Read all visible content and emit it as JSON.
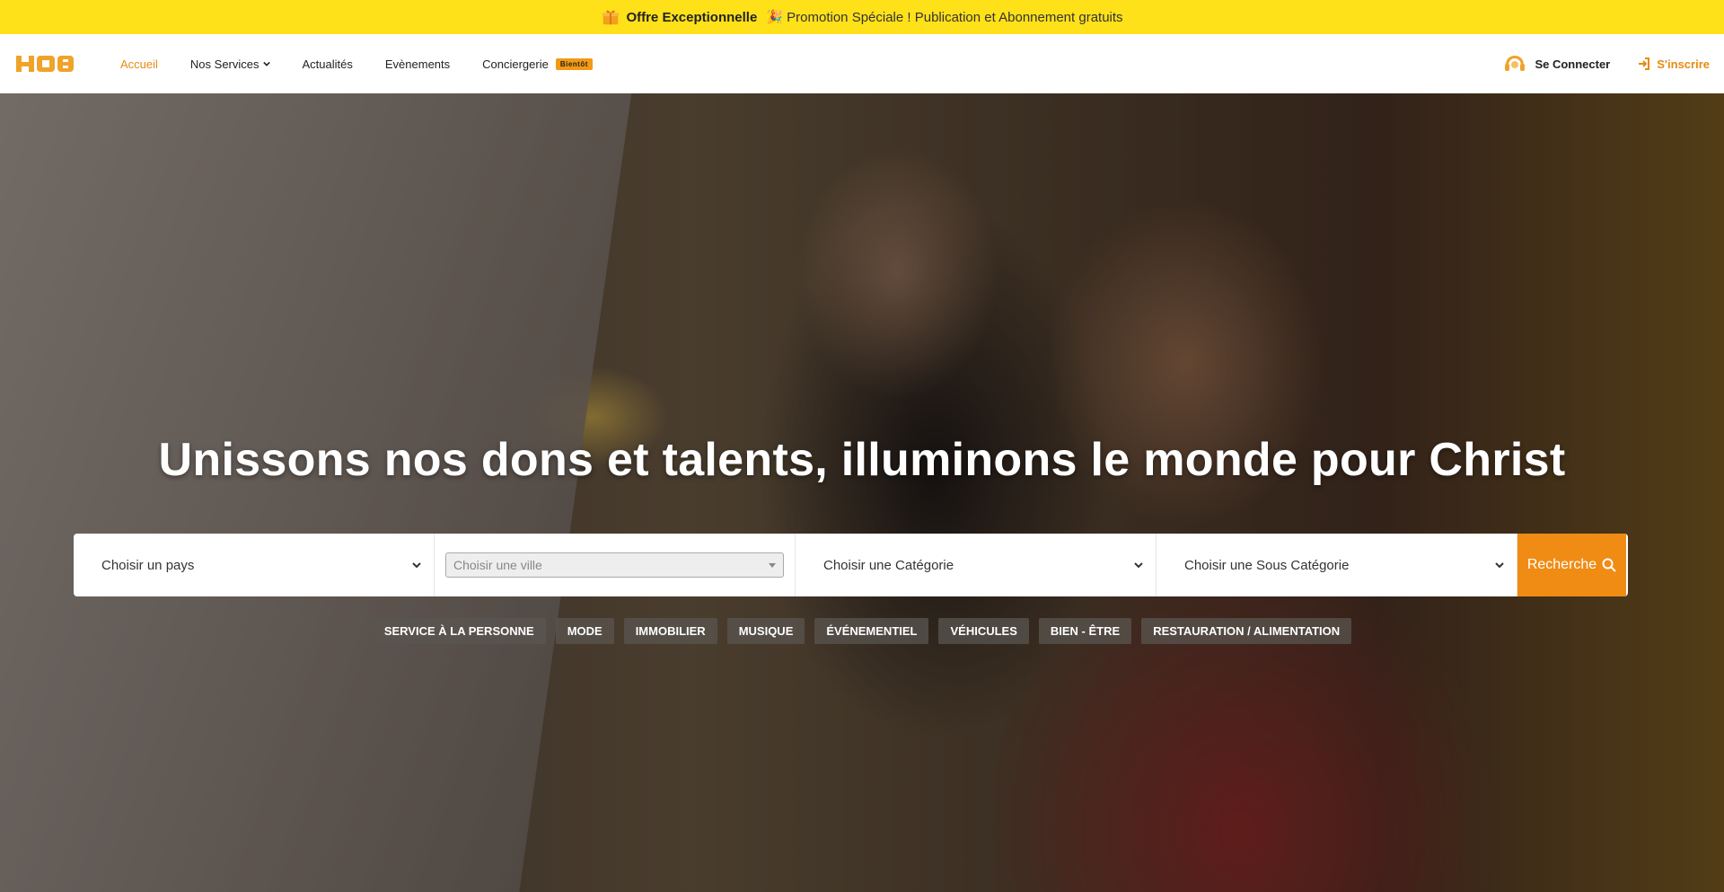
{
  "promo": {
    "title": "Offre Exceptionnelle",
    "text": "🎉 Promotion Spéciale ! Publication et Abonnement gratuits"
  },
  "brand": {
    "logo": "HOB",
    "accent": "#e88a12",
    "banner": "#ffe11a"
  },
  "nav": {
    "items": [
      {
        "label": "Accueil"
      },
      {
        "label": "Nos Services"
      },
      {
        "label": "Actualités"
      },
      {
        "label": "Evènements"
      },
      {
        "label": "Conciergerie"
      }
    ],
    "badge": "Bientôt",
    "login": "Se Connecter",
    "signup": "S'inscrire"
  },
  "hero": {
    "title": "Unissons nos dons et talents, illuminons le monde pour Christ"
  },
  "search": {
    "country": "Choisir un pays",
    "city": "Choisir une ville",
    "category": "Choisir une Catégorie",
    "subcategory": "Choisir une Sous Catégorie",
    "button": "Recherche"
  },
  "tags": [
    "SERVICE À LA PERSONNE",
    "MODE",
    "IMMOBILIER",
    "MUSIQUE",
    "ÉVÉNEMENTIEL",
    "VÉHICULES",
    "BIEN - ÊTRE",
    "RESTAURATION / ALIMENTATION"
  ]
}
